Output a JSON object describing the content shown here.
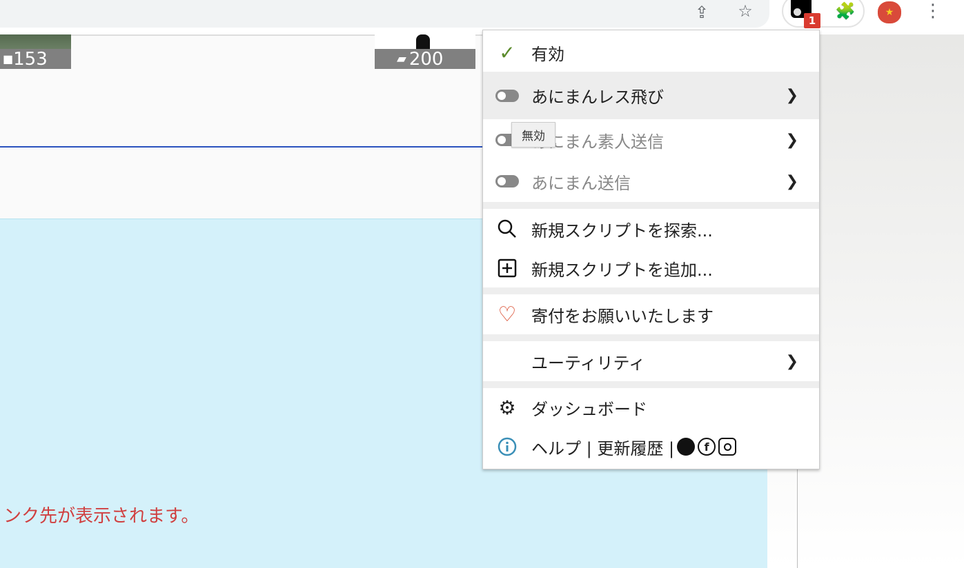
{
  "browser": {
    "icons": [
      "share-icon",
      "star-icon",
      "tampermonkey-icon",
      "extensions-icon",
      "apple-extension-icon",
      "more-icon"
    ],
    "badge": "1"
  },
  "page": {
    "comment_count_1": "153",
    "comment_count_2": "200",
    "notice": "ンク先が表示されます。"
  },
  "menu": {
    "enabled": "有効",
    "scripts": [
      {
        "label": "あにまんレス飛び"
      },
      {
        "label": "あにまん素人送信"
      },
      {
        "label": "あにまん送信"
      }
    ],
    "find_new": "新規スクリプトを探索...",
    "add_new": "新規スクリプトを追加...",
    "donate": "寄付をお願いいたします",
    "utilities": "ユーティリティ",
    "dashboard": "ダッシュボード",
    "help": "ヘルプ | 更新履歴 |"
  },
  "tooltip": "無効",
  "colors": {
    "check": "#5a8a2a",
    "heart": "#d9482b",
    "info": "#3a8fb7",
    "badge": "#d93b30"
  }
}
